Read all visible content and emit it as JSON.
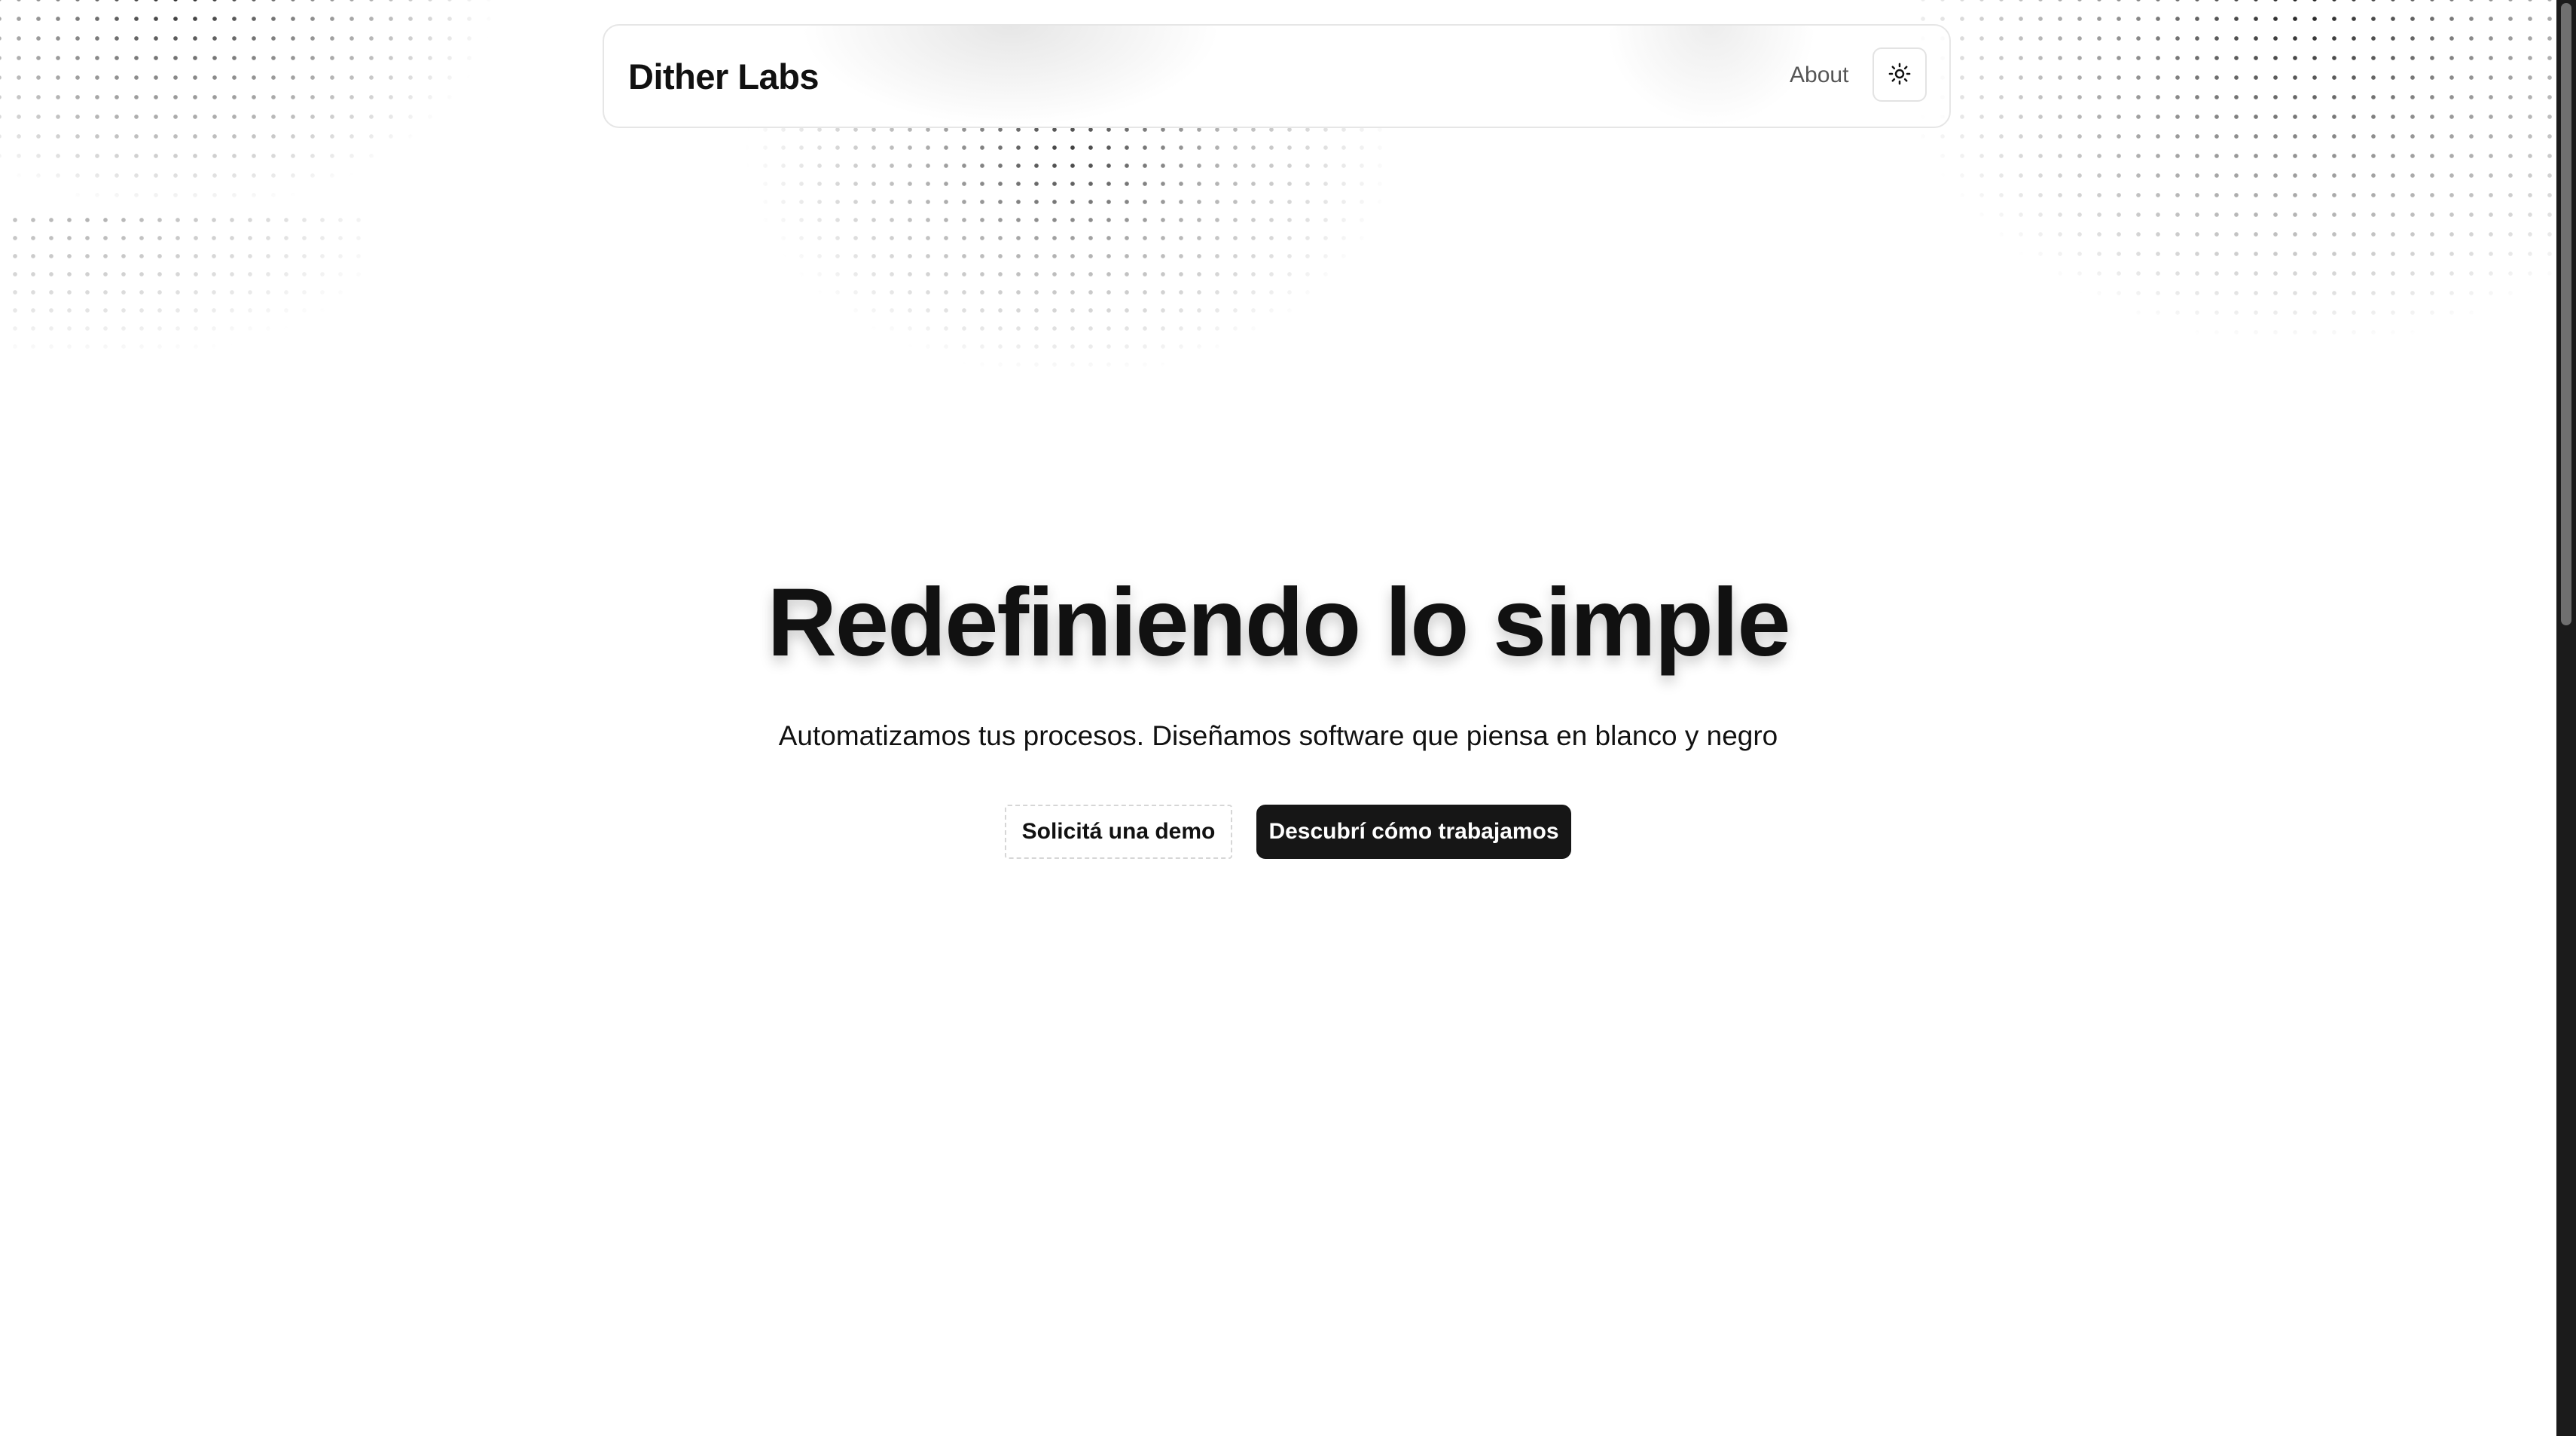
{
  "header": {
    "brand": "Dither Labs",
    "nav": [
      {
        "label": "About"
      }
    ],
    "theme_toggle": {
      "icon": "sun-icon"
    }
  },
  "hero": {
    "title": "Redefiniendo lo simple",
    "subtitle": "Automatizamos tus procesos. Diseñamos software que piensa en blanco y negro",
    "buttons": {
      "secondary_label": "Solicitá una demo",
      "primary_label": "Descubrí cómo trabajamos"
    }
  },
  "theme": {
    "primary_button_bg": "#161616",
    "text": "#111111",
    "nav_text": "#555555",
    "background": "#ffffff"
  }
}
